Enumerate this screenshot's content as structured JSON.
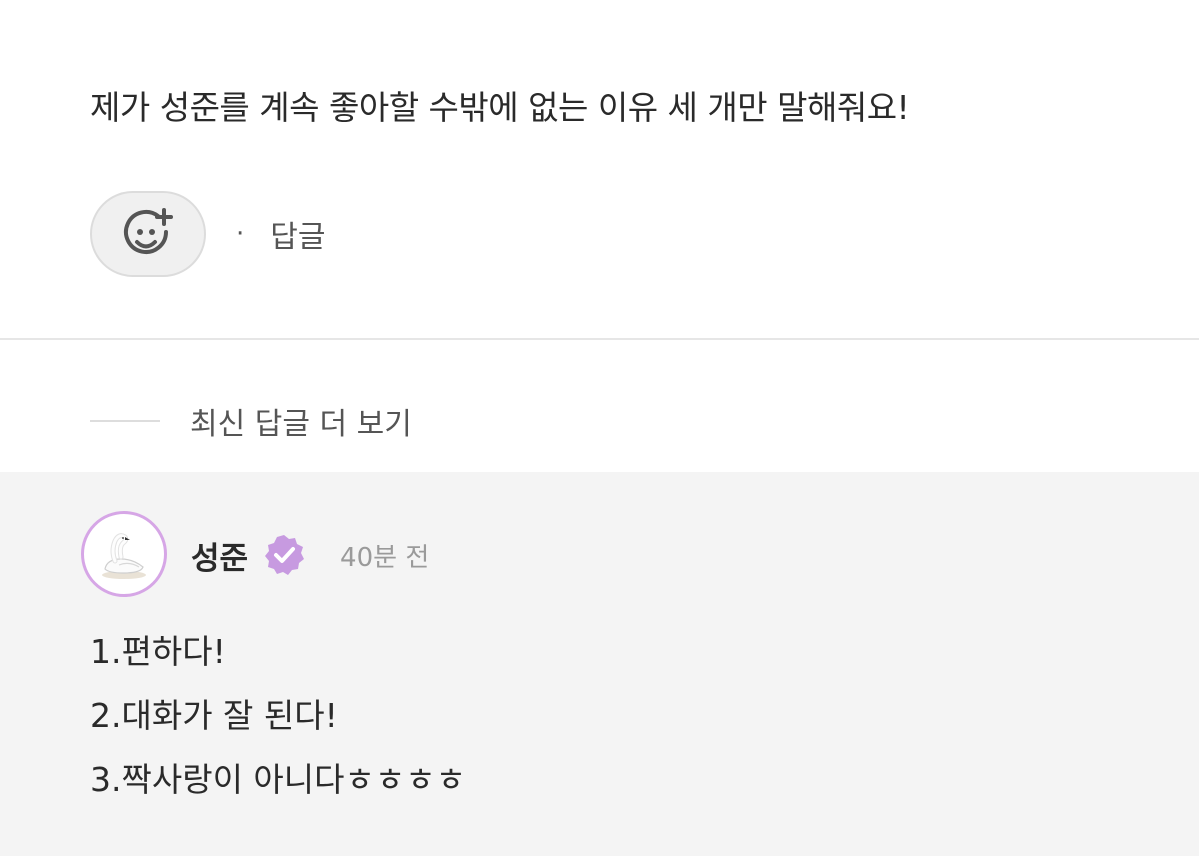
{
  "post": {
    "question": "제가 성준를 계속 좋아할 수밖에 없는 이유 세 개만 말해줘요!",
    "reaction_icon": "add-reaction-smiley-icon",
    "separator": "·",
    "reply_label": "답글"
  },
  "replies_section": {
    "more_label": "최신 답글 더 보기"
  },
  "reply": {
    "avatar_icon": "swan-avatar",
    "author": "성준",
    "verified_icon": "verified-badge-icon",
    "time": "40분 전",
    "lines": [
      "1.편하다!",
      "2.대화가 잘 된다!",
      "3.짝사랑이 아니다ㅎㅎㅎㅎ"
    ]
  },
  "colors": {
    "accent": "#d6a6e6",
    "verified": "#c79ae0",
    "panel_bg": "#f4f4f4",
    "text": "#2a2a2a",
    "muted": "#9a9a9a"
  }
}
